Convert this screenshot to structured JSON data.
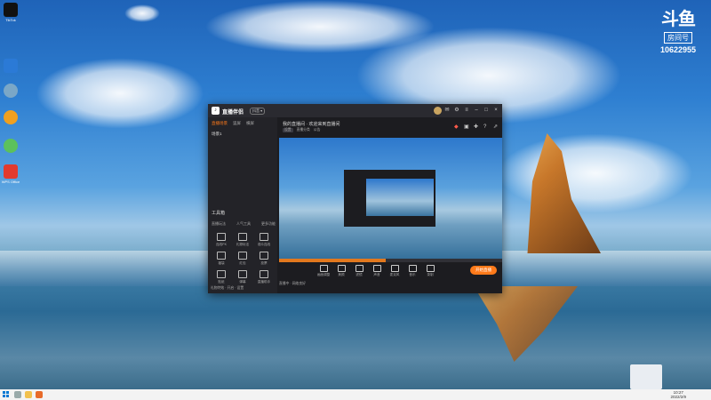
{
  "desktop": {
    "icons": [
      {
        "name": "TikTok",
        "color": "#111111"
      },
      {
        "name": "",
        "color": "#2b7ad6"
      },
      {
        "name": "",
        "color": "#7aa7c7"
      },
      {
        "name": "",
        "color": "#f0a020"
      },
      {
        "name": "",
        "color": "#5cc15c"
      },
      {
        "name": "WPS Office",
        "color": "#e23a2e"
      }
    ]
  },
  "watermark": {
    "logo": "斗鱼",
    "room_label": "房间号",
    "room_number": "10622955"
  },
  "app": {
    "name": "直播伴侣",
    "version_badge": "抖音 ▾",
    "sidebar": {
      "tabs": [
        "直播场景",
        "竖屏",
        "横屏"
      ],
      "scene_label": "场景1",
      "tools_title": "工具箱",
      "tool_groups": [
        "直播玩法",
        "人气工具",
        "更多功能"
      ],
      "tools": [
        "连线PK",
        "礼物玩法",
        "观众连线",
        "福袋",
        "红包",
        "投票",
        "贴纸",
        "弹幕",
        "直播助手"
      ],
      "footer": "礼物特效 · 开启 · 设置"
    },
    "main": {
      "stream_title": "我的直播间 · 欢迎来到直播间",
      "meta": [
        "设置",
        "直播分类",
        "公告"
      ],
      "bottom_items": [
        "画面调整",
        "美颜",
        "滤镜",
        "声音",
        "麦克风",
        "音乐",
        "录制"
      ],
      "go_live_label": "开始直播",
      "footer": "直播中 · 网络良好"
    }
  },
  "taskbar": {
    "time": "10:27",
    "date": "2022/2/9"
  }
}
